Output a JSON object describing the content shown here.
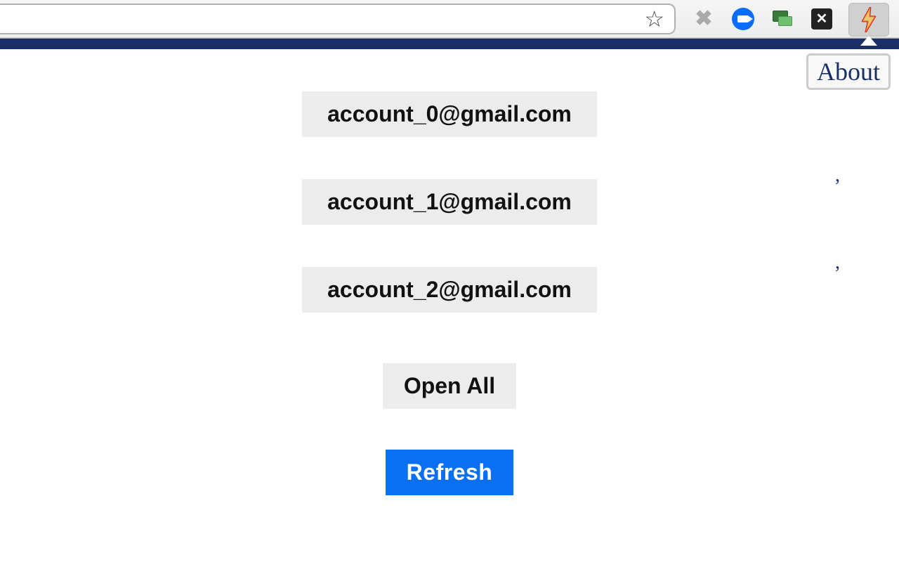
{
  "toolbar": {
    "url_value": "",
    "extensions": {
      "star": "star-icon",
      "x_gray": "x-gray-icon",
      "zoom": "zoom-icon",
      "screenshare": "screenshare-icon",
      "x_black": "x-black-icon",
      "bolt": "bolt-icon"
    }
  },
  "popup": {
    "about_label": "About",
    "accounts": [
      {
        "email": "account_0@gmail.com"
      },
      {
        "email": "account_1@gmail.com"
      },
      {
        "email": "account_2@gmail.com"
      }
    ],
    "open_all_label": "Open All",
    "refresh_label": "Refresh",
    "ticks": [
      ",",
      ","
    ]
  },
  "colors": {
    "header_bar": "#1b2f67",
    "refresh_bg": "#0a6ff0",
    "button_bg": "#ececec"
  }
}
